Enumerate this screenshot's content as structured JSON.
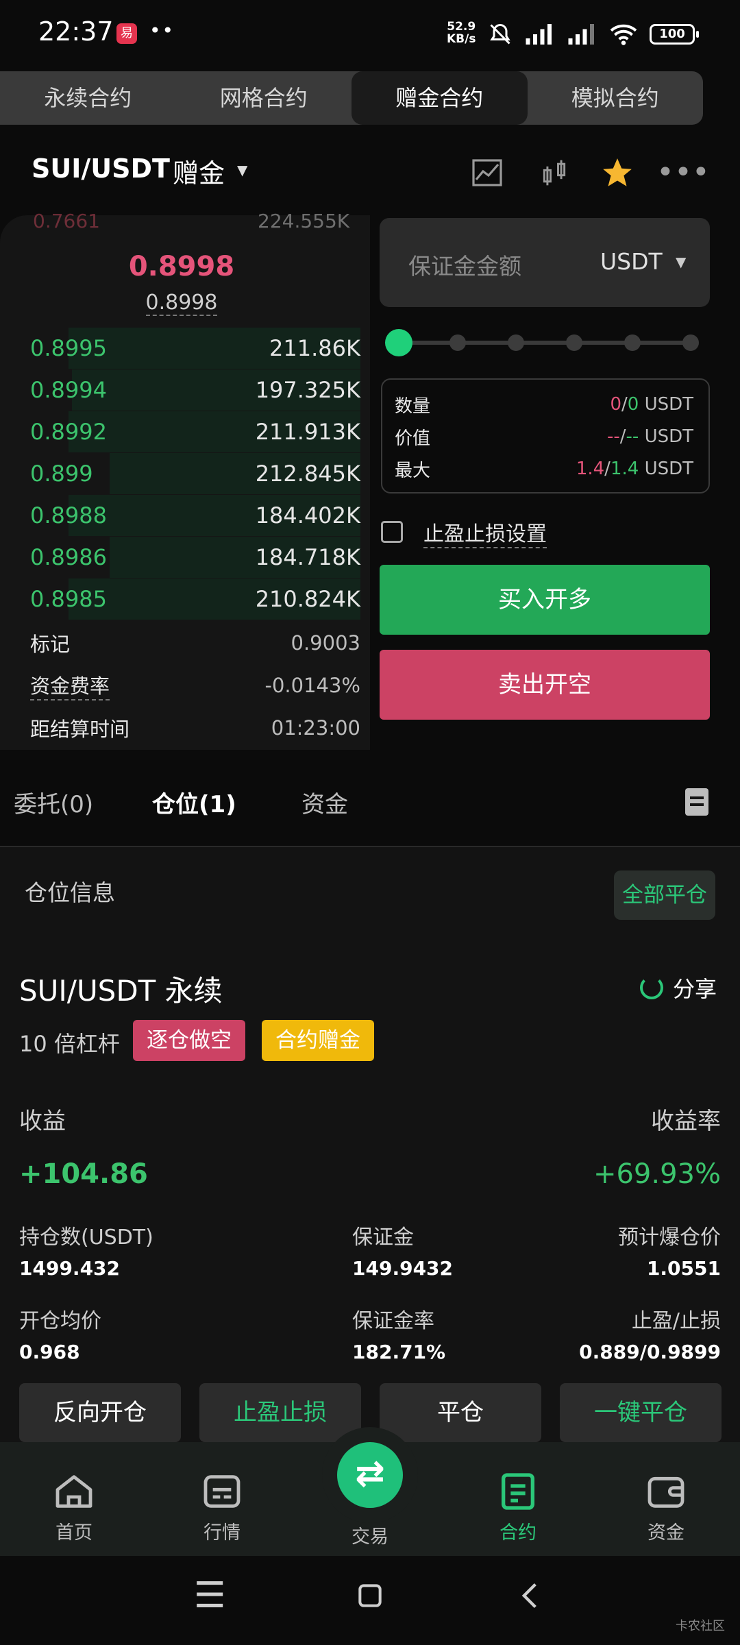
{
  "status_bar": {
    "time": "22:37",
    "app_icon_text": "易",
    "dots": "••",
    "speed_value": "52.9",
    "speed_unit": "KB/s",
    "battery": "100"
  },
  "mode_tabs": [
    "永续合约",
    "网格合约",
    "赠金合约",
    "模拟合约"
  ],
  "header": {
    "pair": "SUI/USDT",
    "mode": "赠金"
  },
  "order_book": {
    "top_partial": {
      "price": "0.7661",
      "qty": "224.555K"
    },
    "last_price": "0.8998",
    "mark_sub": "0.8998",
    "bids": [
      {
        "price": "0.8995",
        "qty": "211.86K"
      },
      {
        "price": "0.8994",
        "qty": "197.325K"
      },
      {
        "price": "0.8992",
        "qty": "211.913K"
      },
      {
        "price": "0.899",
        "qty": "212.845K"
      },
      {
        "price": "0.8988",
        "qty": "184.402K"
      },
      {
        "price": "0.8986",
        "qty": "184.718K"
      },
      {
        "price": "0.8985",
        "qty": "210.824K"
      }
    ],
    "depth_fraction": [
      0.99,
      0.98,
      0.99,
      0.85,
      0.99,
      0.85,
      0.99
    ],
    "mark_label": "标记",
    "mark_value": "0.9003",
    "funding_label": "资金费率",
    "funding_value": "-0.0143%",
    "settle_label": "距结算时间",
    "settle_value": "01:23:00"
  },
  "order_form": {
    "margin_placeholder": "保证金金额",
    "margin_unit": "USDT",
    "rows": [
      {
        "label": "数量",
        "a": "0",
        "sep": "/",
        "b": "0",
        "unit": "USDT"
      },
      {
        "label": "价值",
        "a": "--",
        "sep": "/",
        "b": "--",
        "unit": "USDT"
      },
      {
        "label": "最大",
        "a": "1.4",
        "sep": "/",
        "b": "1.4",
        "unit": "USDT"
      }
    ],
    "tp_sl_label": "止盈止损设置",
    "buy_label": "买入开多",
    "sell_label": "卖出开空"
  },
  "position_tabs": [
    "委托(0)",
    "仓位(1)",
    "资金"
  ],
  "position": {
    "section_title": "仓位信息",
    "close_all": "全部平仓",
    "pair": "SUI/USDT 永续",
    "share": "分享",
    "leverage": "10 倍杠杆",
    "tag_side": "逐仓做空",
    "tag_gift": "合约赠金",
    "pnl_label": "收益",
    "pnl_rate_label": "收益率",
    "pnl": "+104.86",
    "pnl_rate": "+69.93%",
    "stats": [
      {
        "label": "持仓数(USDT)",
        "value": "1499.432"
      },
      {
        "label": "保证金",
        "value": "149.9432"
      },
      {
        "label": "预计爆仓价",
        "value": "1.0551"
      },
      {
        "label": "开仓均价",
        "value": "0.968"
      },
      {
        "label": "保证金率",
        "value": "182.71%"
      },
      {
        "label": "止盈/止损",
        "value": "0.889/0.9899"
      }
    ],
    "actions": [
      "反向开仓",
      "止盈止损",
      "平仓",
      "一键平仓"
    ]
  },
  "bottom_nav": [
    "首页",
    "行情",
    "交易",
    "合约",
    "资金"
  ],
  "watermark": "卡农社区",
  "colors": {
    "green": "#3cc46d",
    "red": "#e5547a",
    "accent": "#2bc779",
    "gift": "#f0b90b"
  }
}
